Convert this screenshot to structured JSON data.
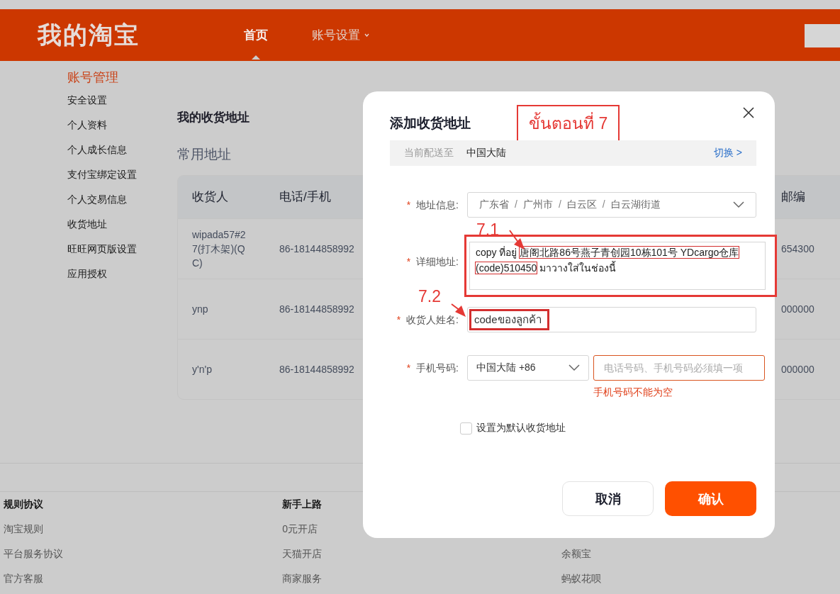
{
  "header": {
    "logo": "我的淘宝",
    "nav": [
      {
        "label": "首页",
        "selected": true,
        "has_menu": false
      },
      {
        "label": "账号设置",
        "selected": false,
        "has_menu": true
      }
    ]
  },
  "sidebar": {
    "title": "账号管理",
    "items": [
      "安全设置",
      "个人资料",
      "个人成长信息",
      "支付宝绑定设置",
      "个人交易信息",
      "收货地址",
      "旺旺网页版设置",
      "应用授权"
    ]
  },
  "main": {
    "title": "我的收货地址",
    "subtitle": "常用地址",
    "table": {
      "columns": [
        "收货人",
        "电话/手机",
        "邮编"
      ],
      "rows": [
        {
          "cells": [
            "wipada57#27(打木架)(QC)",
            "86-18144858992",
            "654300"
          ]
        },
        {
          "cells": [
            "ynp",
            "86-18144858992",
            "000000"
          ]
        },
        {
          "cells": [
            "y'n'p",
            "86-18144858992",
            "000000"
          ]
        }
      ]
    }
  },
  "footer": {
    "columns": [
      {
        "heading": "规则协议",
        "links": [
          "淘宝规则",
          "平台服务协议",
          "官方客服"
        ]
      },
      {
        "heading": "新手上路",
        "links": [
          "0元开店",
          "天猫开店",
          "商家服务"
        ]
      },
      {
        "links": [
          "余额宝",
          "蚂蚁花呗"
        ]
      }
    ]
  },
  "dialog": {
    "title": "添加收货地址",
    "region_bar": {
      "label": "当前配送至",
      "value": "中国大陆",
      "switch_link": "切换 >"
    },
    "fields": [
      {
        "kind": "select",
        "label": "地址信息:",
        "required_mark": "*",
        "separator": "/",
        "parts": [
          "广东省",
          "广州市",
          "白云区",
          "白云湖街道"
        ]
      },
      {
        "kind": "textarea",
        "label": "详细地址:",
        "required_mark": "*",
        "segments": [
          {
            "text": "copy ที่อยู่",
            "highlighted": false
          },
          {
            "text": "唐阁北路86号燕子青创园10栋101号 YDcargo仓库",
            "highlighted": true
          },
          {
            "text": "(code)510450",
            "highlighted": true
          },
          {
            "text": "มาวางใส่ในช่องนี้",
            "highlighted": false
          }
        ]
      },
      {
        "kind": "text",
        "label": "收货人姓名:",
        "required_mark": "*",
        "value": "codeของลูกค้า",
        "highlighted": true
      },
      {
        "kind": "phone",
        "label": "手机号码:",
        "required_mark": "*",
        "country": "中国大陆 +86",
        "placeholder": "电话号码、手机号码必须填一项",
        "error": "手机号码不能为空"
      }
    ],
    "default_checkbox": {
      "label": "设置为默认收货地址",
      "checked": false
    },
    "buttons": [
      {
        "label": "取消",
        "kind": "secondary"
      },
      {
        "label": "确认",
        "kind": "primary"
      }
    ]
  },
  "annotations": {
    "step_label": "ขั้นตอนที่ 7",
    "callouts": [
      "7.1",
      "7.2"
    ]
  }
}
